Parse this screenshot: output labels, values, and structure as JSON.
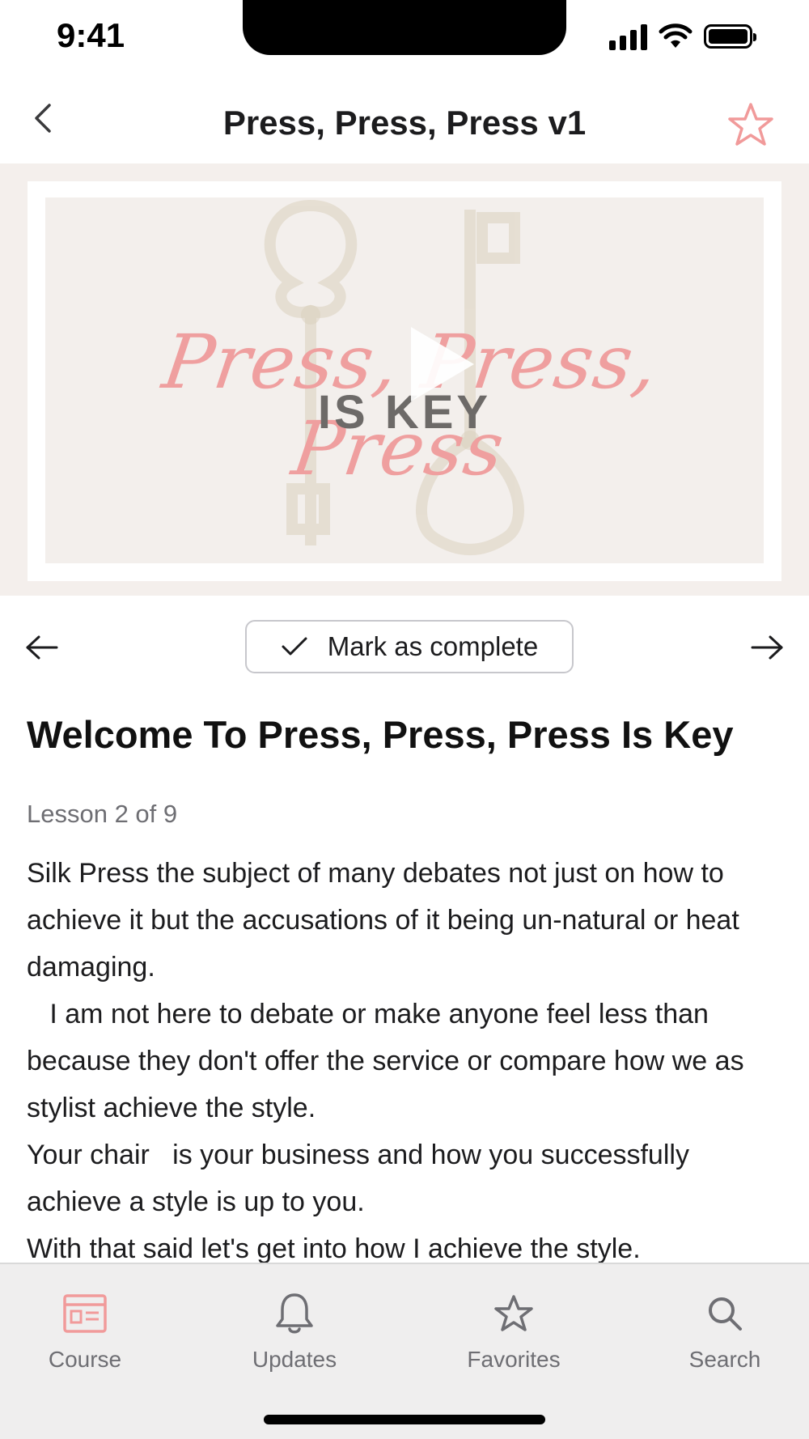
{
  "status_bar": {
    "time": "9:41"
  },
  "header": {
    "title": "Press, Press, Press v1"
  },
  "video": {
    "title_script": "Press, Press, Press",
    "title_sub": "IS KEY"
  },
  "controls": {
    "mark_complete_label": "Mark as complete"
  },
  "lesson": {
    "heading": "Welcome To Press, Press, Press Is Key",
    "progress": "Lesson 2 of 9",
    "paragraphs": [
      "Silk Press the subject of many debates not just on how to achieve it but the accusations of it being un-natural or heat damaging.",
      "   I am not here to debate or make anyone feel less than because they don't offer the service or compare how we as stylist achieve the style.",
      "Your chair   is your business and how you successfully achieve a style is up to you.",
      "With that said let's get into how I achieve the style."
    ]
  },
  "tabs": [
    {
      "label": "Course",
      "icon": "course-icon",
      "active": true
    },
    {
      "label": "Updates",
      "icon": "bell-icon",
      "active": false
    },
    {
      "label": "Favorites",
      "icon": "star-icon",
      "active": false
    },
    {
      "label": "Search",
      "icon": "search-icon",
      "active": false
    }
  ],
  "colors": {
    "accent": "#f19a9a",
    "text": "#1c1c1e",
    "secondary_text": "#6e6e73",
    "tab_bar_bg": "#efeeee"
  }
}
